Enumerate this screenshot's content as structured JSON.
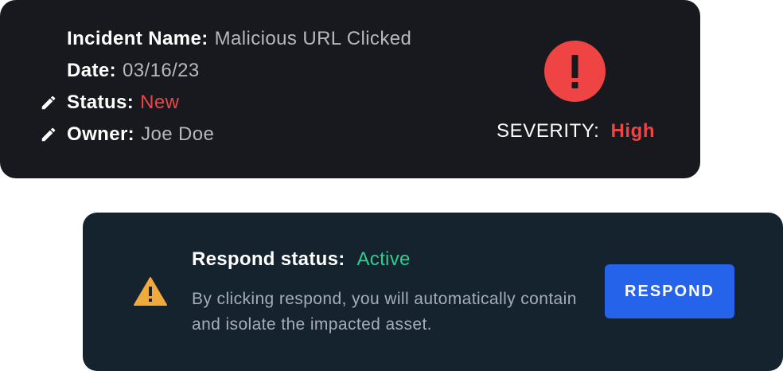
{
  "incident": {
    "name_label": "Incident Name:",
    "name_value": "Malicious URL Clicked",
    "date_label": "Date:",
    "date_value": "03/16/23",
    "status_label": "Status:",
    "status_value": "New",
    "owner_label": "Owner:",
    "owner_value": "Joe Doe",
    "severity_label": "SEVERITY:",
    "severity_value": "High",
    "icons": {
      "edit": "pencil-icon",
      "severity": "exclamation-circle-icon"
    },
    "colors": {
      "card_bg": "#17191e",
      "status_new": "#ef4444",
      "severity_high": "#ef4444",
      "alert_circle": "#ef4444"
    }
  },
  "respond": {
    "title_label": "Respond status:",
    "title_value": "Active",
    "description": "By clicking respond, you will automatically contain and isolate the impacted asset.",
    "button_label": "RESPOND",
    "icons": {
      "warning": "warning-triangle-icon"
    },
    "colors": {
      "card_bg": "#15232f",
      "status_active": "#2ecc8f",
      "button_bg": "#2563eb",
      "warning": "#f0a93b"
    }
  }
}
